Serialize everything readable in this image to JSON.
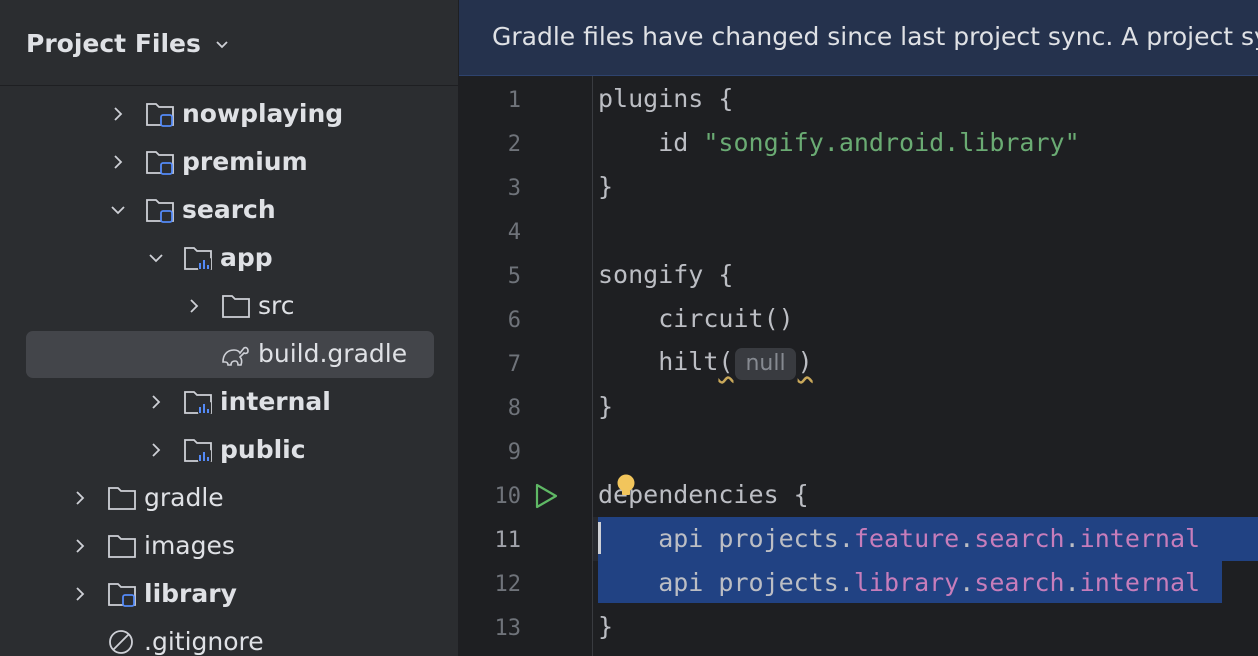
{
  "sidebar": {
    "title": "Project Files",
    "items": [
      {
        "label": "nowplaying",
        "kind": "module-folder",
        "expanded": false
      },
      {
        "label": "premium",
        "kind": "module-folder",
        "expanded": false
      },
      {
        "label": "search",
        "kind": "module-folder",
        "expanded": true
      },
      {
        "label": "app",
        "kind": "android-module-folder",
        "expanded": true
      },
      {
        "label": "src",
        "kind": "folder",
        "expanded": false
      },
      {
        "label": "build.gradle",
        "kind": "gradle-file",
        "selected": true
      },
      {
        "label": "internal",
        "kind": "android-module-folder",
        "expanded": false
      },
      {
        "label": "public",
        "kind": "android-module-folder",
        "expanded": false
      },
      {
        "label": "gradle",
        "kind": "folder",
        "expanded": false
      },
      {
        "label": "images",
        "kind": "folder",
        "expanded": false
      },
      {
        "label": "library",
        "kind": "module-folder",
        "expanded": false
      },
      {
        "label": ".gitignore",
        "kind": "ignored-file"
      }
    ]
  },
  "editor": {
    "banner": "Gradle files have changed since last project sync. A project sync may be necessary for the IDE to work properly.",
    "line_numbers": [
      "1",
      "2",
      "3",
      "4",
      "5",
      "6",
      "7",
      "8",
      "9",
      "10",
      "11",
      "12",
      "13"
    ],
    "inlay_hint": "null",
    "code": {
      "l1": "plugins {",
      "l2_a": "    id ",
      "l2_str": "\"songify.android.library\"",
      "l3": "}",
      "l5": "songify {",
      "l6": "    circuit()",
      "l7_a": "    hilt",
      "l7_open": "(",
      "l7_close": ")",
      "l8": "}",
      "l10": "dependencies {",
      "l11_a": "    api projects.",
      "l11_p1": "feature",
      "l11_p2": "search",
      "l11_p3": "internal",
      "l12_a": "    api projects.",
      "l12_p1": "library",
      "l12_p2": "search",
      "l12_p3": "internal",
      "dot": ".",
      "l13": "}"
    }
  },
  "colors": {
    "sidebar_bg": "#2b2d30",
    "editor_bg": "#1e1f22",
    "banner_bg": "#25324d",
    "selection": "#214283",
    "string": "#6aab73",
    "property": "#c77dbb",
    "run_icon": "#5fb865",
    "bulb": "#f2c55c"
  },
  "icons": [
    "chevron-down-icon",
    "chevron-right-icon",
    "module-folder-icon",
    "android-module-folder-icon",
    "folder-icon",
    "gradle-icon",
    "ignore-icon",
    "run-icon",
    "lightbulb-icon"
  ]
}
